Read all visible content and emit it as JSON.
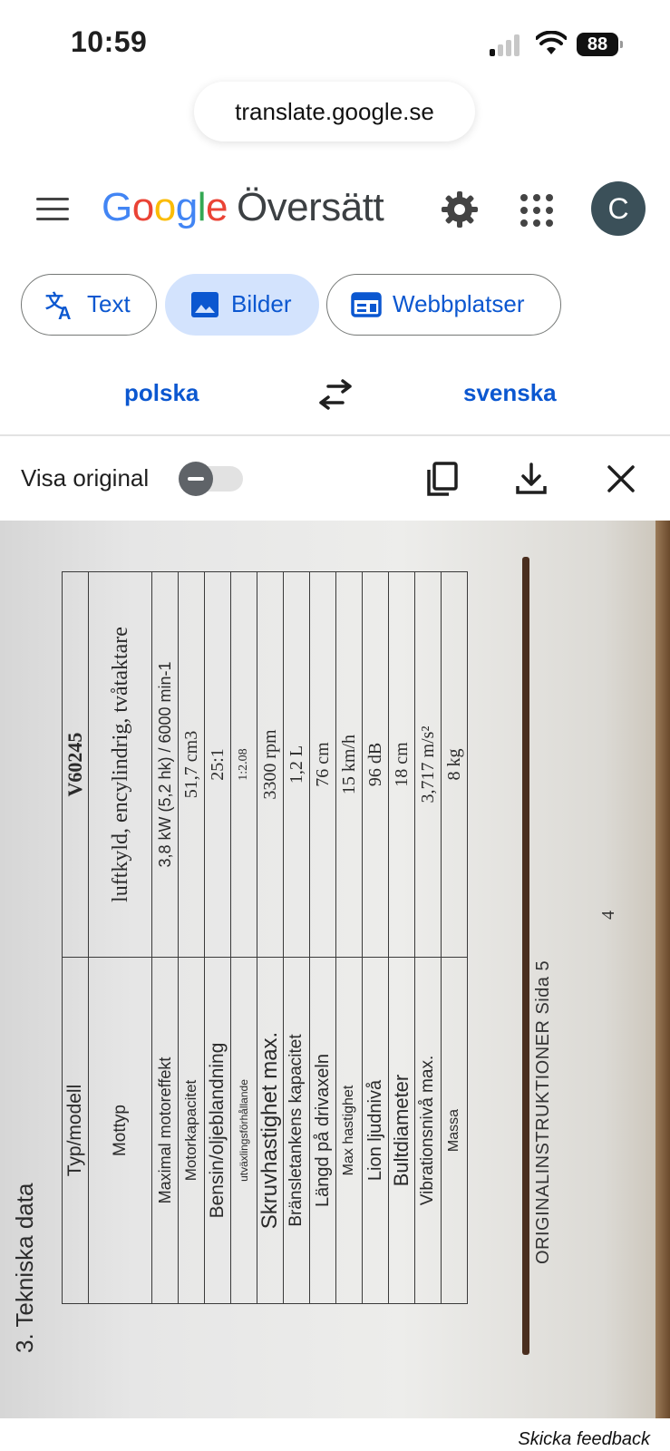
{
  "status_bar": {
    "time": "10:59",
    "battery": "88"
  },
  "browser": {
    "url": "translate.google.se"
  },
  "app": {
    "logo_letters": [
      "G",
      "o",
      "o",
      "g",
      "l",
      "e"
    ],
    "product_name": "Översätt",
    "avatar_initial": "C"
  },
  "tabs": [
    {
      "label": "Text",
      "active": false
    },
    {
      "label": "Bilder",
      "active": true
    },
    {
      "label": "Webbplatser",
      "active": false
    }
  ],
  "languages": {
    "source": "polska",
    "target": "svenska"
  },
  "toolbar": {
    "show_original_label": "Visa original",
    "show_original_on": false
  },
  "document": {
    "heading": "3. Tekniska data",
    "table": [
      {
        "key": "Typ/modell",
        "value": "V60245"
      },
      {
        "key": "Mottyp",
        "value": "luftkyld, encylindrig, tvåtaktare"
      },
      {
        "key": "Maximal motoreffekt",
        "value": "3,8 kW (5,2 hk) / 6000 min-1"
      },
      {
        "key": "Motorkapacitet",
        "value": "51,7 cm3"
      },
      {
        "key": "Bensin/oljeblandning",
        "value": "25:1"
      },
      {
        "key": "utväxlingsförhållande",
        "value": "1:2.08"
      },
      {
        "key": "Skruvhastighet max.",
        "value": "3300 rpm"
      },
      {
        "key": "Bränsletankens kapacitet",
        "value": "1,2 L"
      },
      {
        "key": "Längd på drivaxeln",
        "value": "76 cm"
      },
      {
        "key": "Max hastighet",
        "value": "15 km/h"
      },
      {
        "key": "Lion ljudnivå",
        "value": "96 dB"
      },
      {
        "key": "Bultdiameter",
        "value": "18 cm"
      },
      {
        "key": "Vibrationsnivå max.",
        "value": "3,717 m/s²"
      },
      {
        "key": "Massa",
        "value": "8 kg"
      }
    ],
    "page_number": "4",
    "footer_text": "ORIGINALINSTRUKTIONER Sida 5"
  },
  "feedback_link": "Skicka feedback",
  "colors": {
    "accent": "#0b57d0",
    "active_chip": "#d3e3fd",
    "avatar": "#3b5059"
  }
}
